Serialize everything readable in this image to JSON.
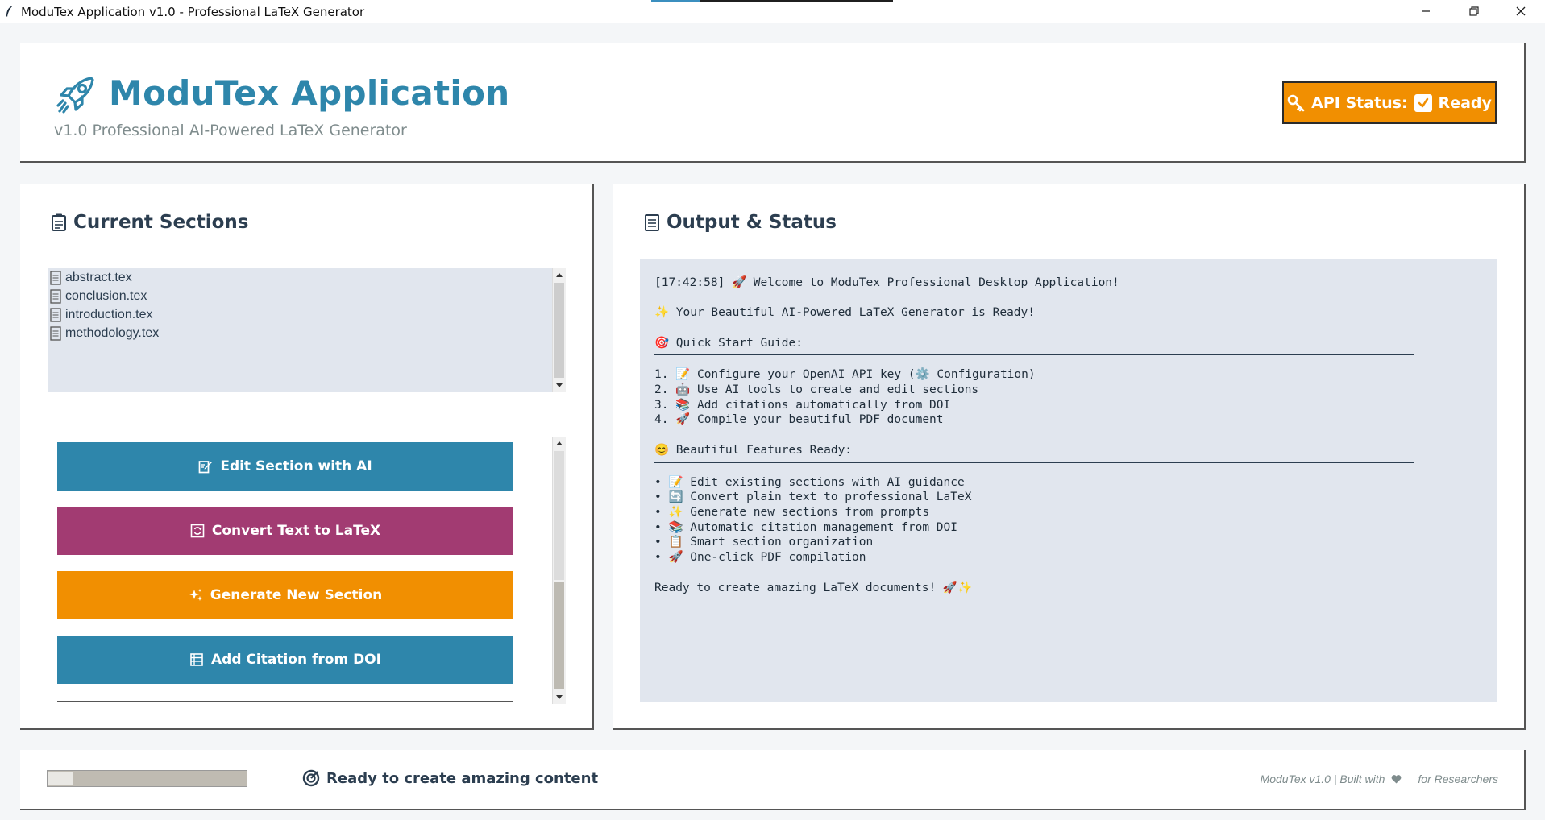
{
  "window": {
    "title": "ModuTex Application v1.0 - Professional LaTeX Generator"
  },
  "header": {
    "app_title": "ModuTex Application",
    "subtitle": "v1.0 Professional AI-Powered LaTeX Generator",
    "logo_icon": "rocket-icon",
    "api_status_label": "API Status:",
    "api_status_value": "Ready"
  },
  "sections_panel": {
    "heading": "Current Sections",
    "files": [
      {
        "name": "abstract.tex",
        "icon": "document-icon"
      },
      {
        "name": "conclusion.tex",
        "icon": "document-icon"
      },
      {
        "name": "introduction.tex",
        "icon": "document-icon"
      },
      {
        "name": "methodology.tex",
        "icon": "document-icon"
      }
    ],
    "actions": [
      {
        "label": "Edit Section with AI",
        "color": "#2e86ab",
        "icon": "edit-icon"
      },
      {
        "label": "Convert Text to LaTeX",
        "color": "#a23b72",
        "icon": "convert-icon"
      },
      {
        "label": "Generate New Section",
        "color": "#f18f01",
        "icon": "sparkle-icon"
      },
      {
        "label": "Add Citation from DOI",
        "color": "#2e86ab",
        "icon": "book-icon"
      }
    ]
  },
  "output_panel": {
    "heading": "Output & Status",
    "welcome": "[17:42:58] 🚀 Welcome to ModuTex Professional Desktop Application!",
    "ready": "✨ Your Beautiful AI-Powered LaTeX Generator is Ready!",
    "quick_start_heading": "🎯 Quick Start Guide:",
    "quick_start_items": [
      "1. 📝 Configure your OpenAI API key (⚙️ Configuration)",
      "2. 🤖 Use AI tools to create and edit sections",
      "3. 📚 Add citations automatically from DOI",
      "4. 🚀 Compile your beautiful PDF document"
    ],
    "features_heading": "😊 Beautiful Features Ready:",
    "features": [
      "• 📝 Edit existing sections with AI guidance",
      "• 🔄 Convert plain text to professional LaTeX",
      "• ✨ Generate new sections from prompts",
      "• 📚 Automatic citation management from DOI",
      "• 📋 Smart section organization",
      "• 🚀 One-click PDF compilation"
    ],
    "closing": "Ready to create amazing LaTeX documents! 🚀✨"
  },
  "footer": {
    "progress_fraction": 0.12,
    "status_message": "Ready to create amazing content",
    "credit_prefix": "ModuTex v1.0 | Built with",
    "credit_suffix": "for Researchers"
  },
  "colors": {
    "primary": "#2e86ab",
    "secondary": "#a23b72",
    "accent": "#f18f01",
    "panel_bg": "#e1e6ee"
  }
}
